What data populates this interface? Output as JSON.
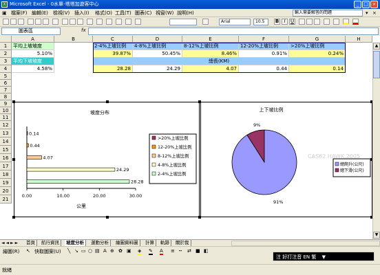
{
  "window": {
    "title": "Microsoft Excel - 0水單-塔塔加遊客中心",
    "icon_text": "X"
  },
  "menu": [
    "檔案(F)",
    "編輯(E)",
    "檢視(V)",
    "插入(I)",
    "格式(O)",
    "工具(T)",
    "圖表(C)",
    "視窗(W)",
    "說明(H)"
  ],
  "help_placeholder": "輸入需要解答的問題",
  "toolbar": {
    "font_name": "Arial",
    "font_size": "10.5",
    "bold": "B",
    "italic": "I",
    "underline": "U"
  },
  "name_box": "圖表區",
  "fx_label": "fx",
  "columns": [
    "A",
    "B",
    "C",
    "D",
    "E",
    "F",
    "G",
    "H"
  ],
  "rows": [
    "1",
    "2",
    "3",
    "4",
    "5",
    "6",
    "7",
    "8",
    "9",
    "10",
    "11",
    "12",
    "13",
    "14",
    "15",
    "16",
    "17",
    "18",
    "19",
    "20",
    "21"
  ],
  "cells": {
    "a1": "平均上坡坡度",
    "a2": "5.10%",
    "a3": "平均下坡坡度",
    "a4": "4.58%",
    "c1": "2-4%上坡比例",
    "d1": "4-8%上坡比例",
    "e1": "8-12%上坡比例",
    "f1": "12-20%上坡比例",
    "g1": ">20%上坡比例",
    "c2": "39.87%",
    "d2": "50.45%",
    "e2": "8.46%",
    "f2": "0.91%",
    "g2": "0.24%",
    "e3": "總長(KM)",
    "c4": "28.28",
    "d4": "24.29",
    "e4": "4.07",
    "f4": "0.44",
    "g4": "0.14"
  },
  "chart_data": [
    {
      "type": "bar",
      "title": "坡度分布",
      "xlabel": "公里",
      "categories": [
        "2-4%上坡比例",
        "4-8%上坡比例",
        "8-12%上坡比例",
        "12-20%上坡比例",
        ">20%上坡比例"
      ],
      "values": [
        28.28,
        24.29,
        4.07,
        0.44,
        0.14
      ],
      "xlim": [
        0,
        30
      ],
      "xticks": [
        "0.00",
        "10.00",
        "20.00",
        "30.00"
      ],
      "colors": [
        "#ccffcc",
        "#ffffcc",
        "#ffcc99",
        "#ff9900",
        "#993366"
      ],
      "legend_position": "right"
    },
    {
      "type": "pie",
      "title": "上下坡比例",
      "labels": [
        "總爬升(公尺)",
        "總下滑(公尺)"
      ],
      "values": [
        91,
        9
      ],
      "value_labels": [
        "91%",
        "9%"
      ],
      "colors": [
        "#9999ff",
        "#993366"
      ],
      "legend_position": "right"
    }
  ],
  "sheet_tabs": [
    "首頁",
    "航行資訊",
    "坡度分析",
    "運動分析",
    "繪圖資料圖",
    "計算",
    "軌跡",
    "關於我"
  ],
  "active_tab": "坡度分析",
  "drawbar": {
    "draw_label": "繪圖(R)",
    "autoshape_label": "快取圖案(U)"
  },
  "ime": {
    "text": "注 好打注音  EN  繁"
  },
  "status": "就緒",
  "watermark": "CAS62.HAWK.2005"
}
